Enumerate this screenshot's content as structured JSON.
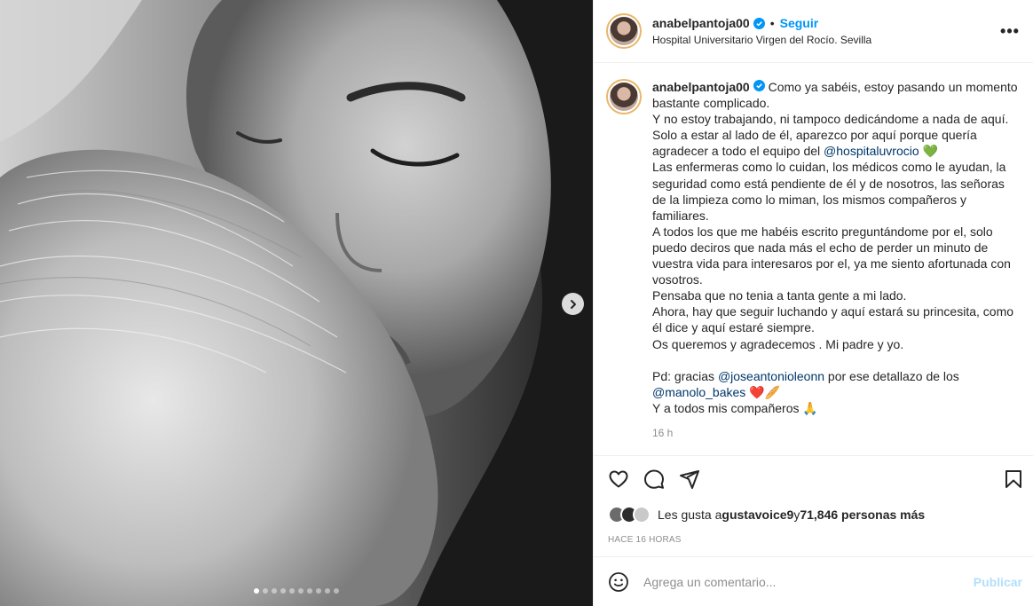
{
  "post": {
    "username": "anabelpantoja00",
    "follow_label": "Seguir",
    "separator": "•",
    "location": "Hospital Universitario Virgen del Rocío. Sevilla",
    "more_label": "•••",
    "carousel": {
      "total_slides": 10,
      "current_slide": 1
    }
  },
  "caption": {
    "username": "anabelpantoja00",
    "part1": " Como ya sabéis, estoy pasando un momento bastante complicado.\nY no estoy trabajando, ni tampoco dedicándome a nada de aquí.\nSolo a estar al lado de él, aparezco por aquí porque quería agradecer a todo el equipo del ",
    "mention1": "@hospitaluvrocio",
    "part2": " 💚\nLas enfermeras como lo cuidan, los médicos como le ayudan, la seguridad como está pendiente de él y de nosotros, las señoras de la limpieza como lo miman, los mismos compañeros y familiares.\nA todos los que me habéis escrito preguntándome por el, solo puedo deciros que nada más el echo de perder un minuto de vuestra vida para interesaros por el, ya me siento afortunada con vosotros.\nPensaba que no tenia a tanta gente a mi lado.\nAhora, hay que seguir luchando y aquí estará su princesita, como él dice y aquí estaré siempre.\nOs queremos y agradecemos . Mi padre y yo.\n\nPd: gracias ",
    "mention2": "@joseantonioleonn",
    "part3": " por ese detallazo de los\n",
    "mention3": "@manolo_bakes",
    "part4": " ❤️🥖\nY a todos mis compañeros 🙏",
    "time": "16 h"
  },
  "likes": {
    "prefix": "Les gusta a ",
    "user": "gustavoice9",
    "middle": " y ",
    "count": "71,846 personas más"
  },
  "posted_ago": "HACE 16 HORAS",
  "comment": {
    "placeholder": "Agrega un comentario...",
    "publish_label": "Publicar"
  }
}
